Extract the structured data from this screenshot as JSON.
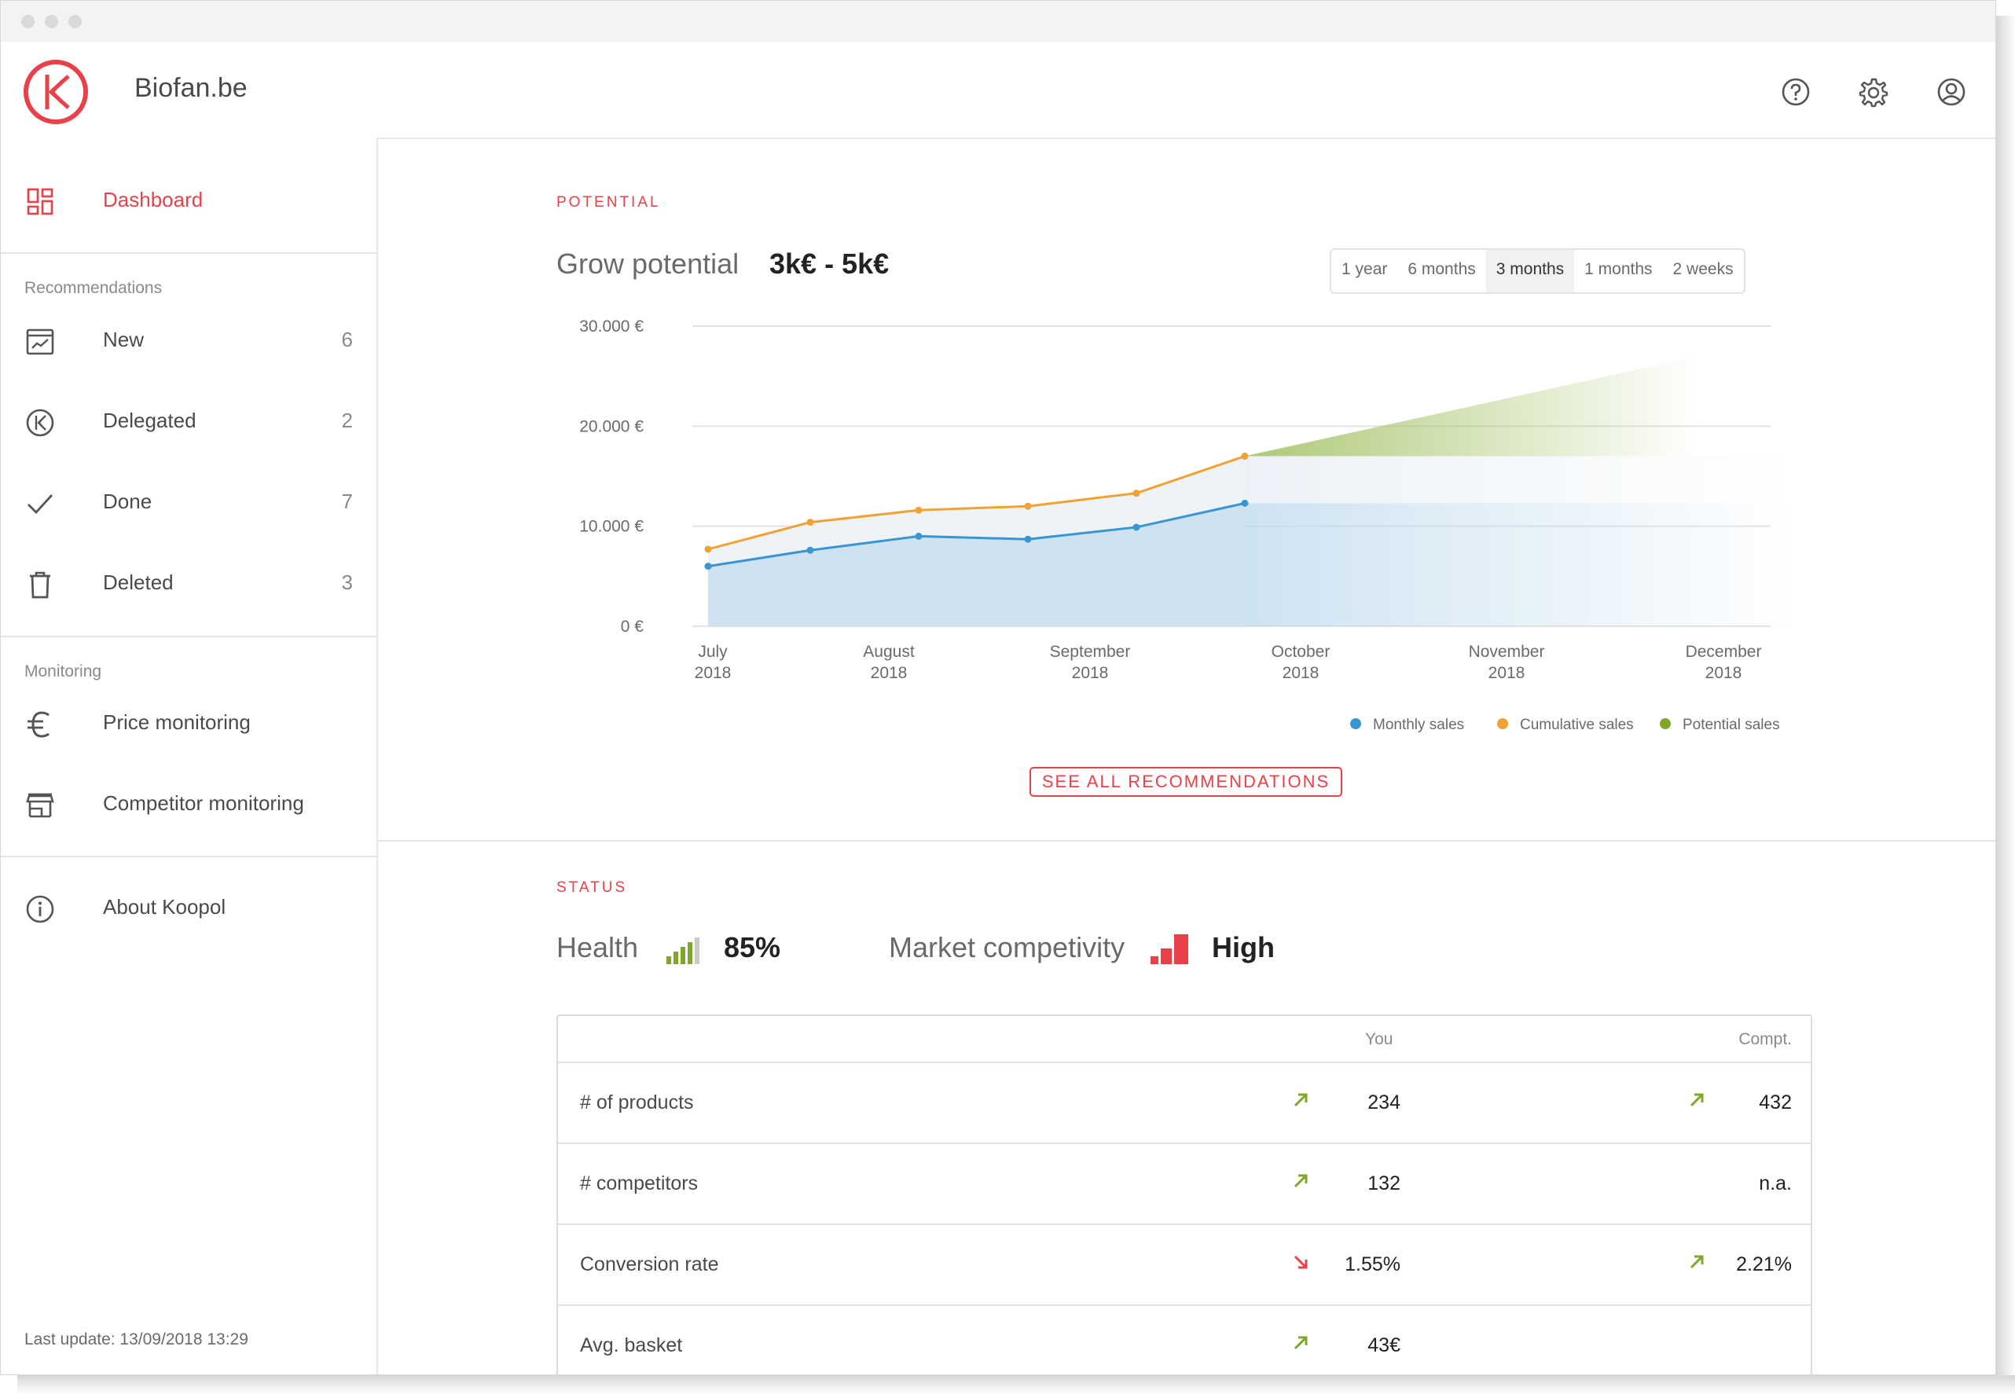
{
  "app": {
    "site_name": "Biofan.be"
  },
  "header": {
    "icons": [
      "help-icon",
      "gear-icon",
      "user-icon"
    ]
  },
  "sidebar": {
    "dashboard_label": "Dashboard",
    "recommendations_label": "Recommendations",
    "recommendations": [
      {
        "label": "New",
        "count": "6",
        "icon": "chart-card-icon"
      },
      {
        "label": "Delegated",
        "count": "2",
        "icon": "koopol-circle-icon"
      },
      {
        "label": "Done",
        "count": "7",
        "icon": "check-icon"
      },
      {
        "label": "Deleted",
        "count": "3",
        "icon": "trash-icon"
      }
    ],
    "monitoring_label": "Monitoring",
    "monitoring": [
      {
        "label": "Price monitoring",
        "icon": "euro-icon"
      },
      {
        "label": "Competitor monitoring",
        "icon": "store-icon"
      }
    ],
    "about_label": "About Koopol",
    "last_update": "Last update: 13/09/2018 13:29"
  },
  "potential": {
    "section_title": "POTENTIAL",
    "grow_label": "Grow potential",
    "grow_value": "3k€ - 5k€",
    "ranges": [
      "1 year",
      "6 months",
      "3 months",
      "1 months",
      "2 weeks"
    ],
    "selected_range": "3 months",
    "see_all_label": "SEE ALL RECOMMENDATIONS"
  },
  "chart_data": {
    "type": "line",
    "y_ticks": [
      "30.000 €",
      "20.000 €",
      "10.000 €",
      "0 €"
    ],
    "ylim": [
      0,
      30000
    ],
    "x_ticks": [
      {
        "month": "July",
        "year": "2018"
      },
      {
        "month": "August",
        "year": "2018"
      },
      {
        "month": "September",
        "year": "2018"
      },
      {
        "month": "October",
        "year": "2018"
      },
      {
        "month": "November",
        "year": "2018"
      },
      {
        "month": "December",
        "year": "2018"
      }
    ],
    "series": [
      {
        "name": "Monthly sales",
        "color": "#3a96d2",
        "values": [
          6000,
          7600,
          9000,
          8700,
          9900,
          12300
        ]
      },
      {
        "name": "Cumulative sales",
        "color": "#f0a232",
        "values": [
          7700,
          10400,
          11600,
          12000,
          13300,
          17000
        ]
      },
      {
        "name": "Potential sales",
        "color": "#7fa82a",
        "values": [
          17000,
          27000
        ]
      }
    ],
    "legend_position": "bottom-right"
  },
  "status": {
    "section_title": "STATUS",
    "health_label": "Health",
    "health_value": "85%",
    "competitivity_label": "Market competivity",
    "competitivity_value": "High",
    "colors": {
      "up": "#7fa82a",
      "down": "#e8414a"
    }
  },
  "table": {
    "headers": {
      "you": "You",
      "compt": "Compt."
    },
    "rows": [
      {
        "label": "# of products",
        "you_trend": "up",
        "you": "234",
        "compt_trend": "up",
        "compt": "432"
      },
      {
        "label": "# competitors",
        "you_trend": "up",
        "you": "132",
        "compt_trend": "",
        "compt": "n.a."
      },
      {
        "label": "Conversion rate",
        "you_trend": "down",
        "you": "1.55%",
        "compt_trend": "up",
        "compt": "2.21%"
      },
      {
        "label": "Avg. basket",
        "you_trend": "up",
        "you": "43€",
        "compt_trend": "",
        "compt": ""
      }
    ]
  }
}
